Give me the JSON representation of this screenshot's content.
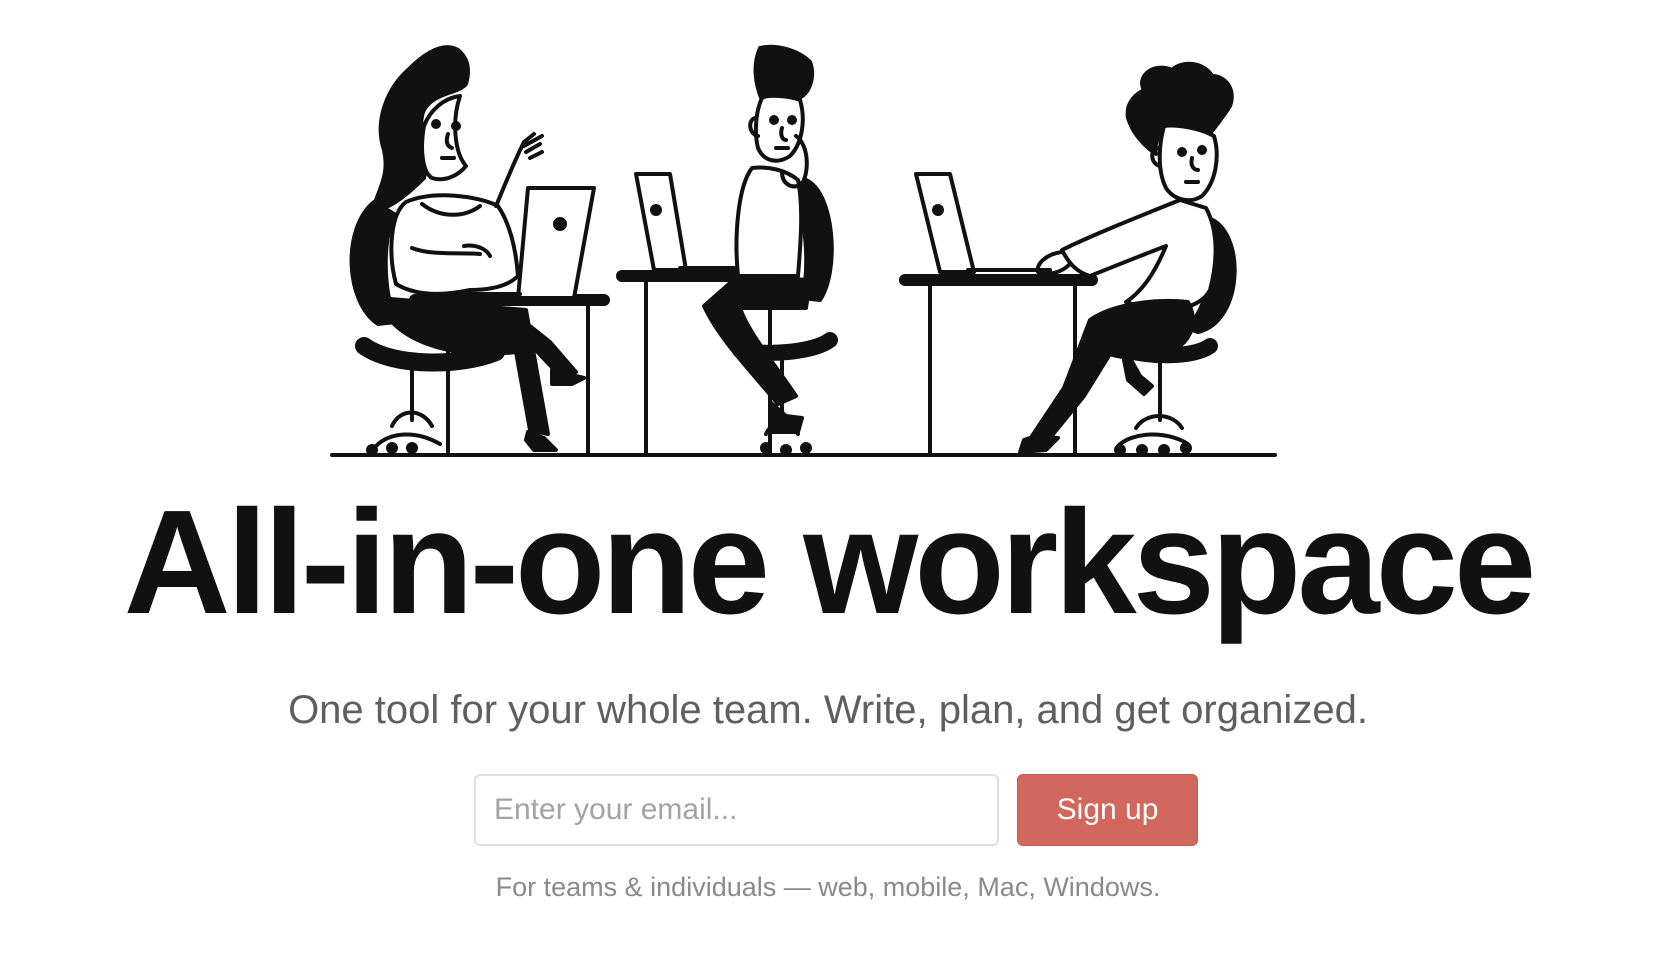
{
  "hero": {
    "headline": "All-in-one workspace",
    "subheadline": "One tool for your whole team. Write, plan, and get organized."
  },
  "signup": {
    "email_placeholder": "Enter your email...",
    "email_value": "",
    "button_label": "Sign up"
  },
  "platform_note": "For teams & individuals — web, mobile, Mac, Windows.",
  "colors": {
    "accent": "#d2685d",
    "text_primary": "#111111",
    "text_secondary": "#5f5f5f",
    "text_muted": "#8a8a8a",
    "input_border": "#dedede"
  },
  "illustration": {
    "icon": "people-working-on-laptops-illustration"
  }
}
